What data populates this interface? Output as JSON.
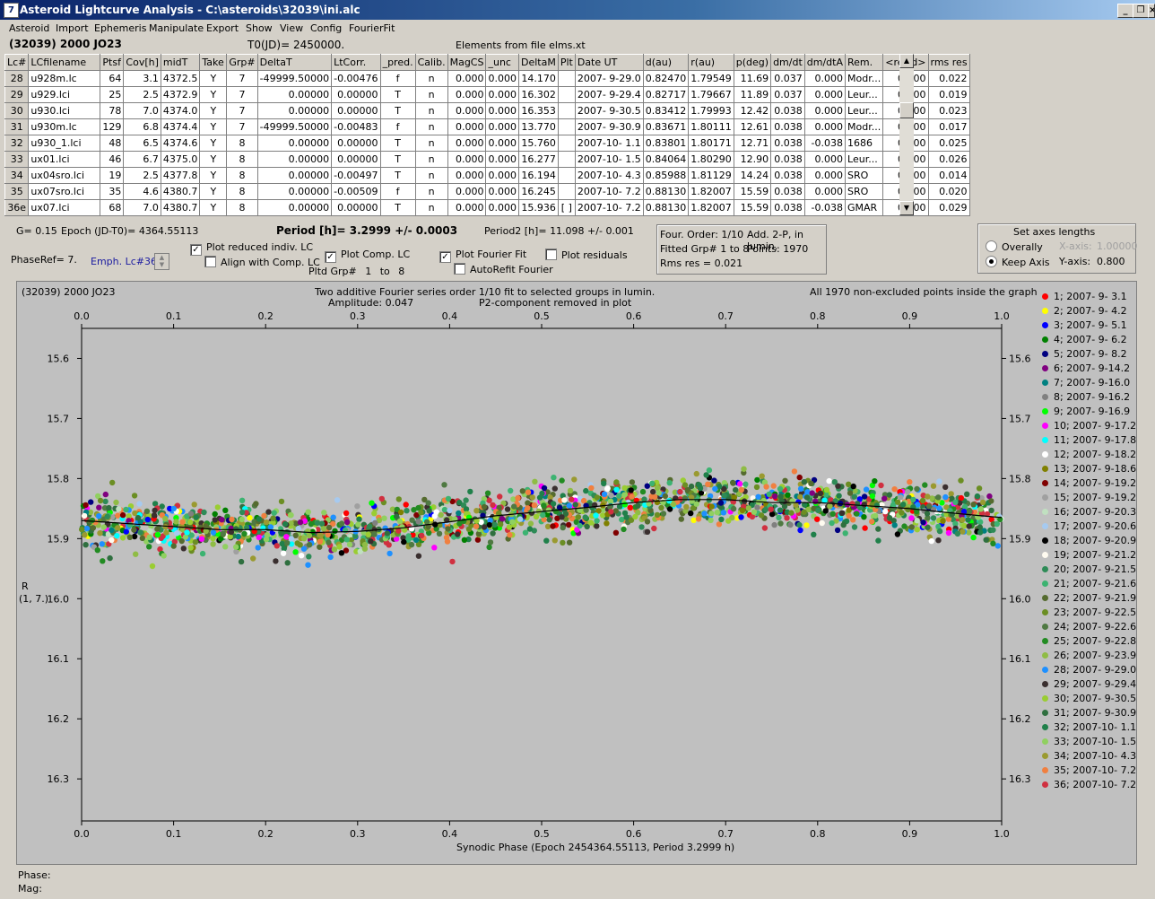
{
  "window": {
    "title": "Asteroid Lightcurve Analysis - C:\\asteroids\\32039\\ini.alc",
    "icon": "app-icon"
  },
  "menu": [
    "Asteroid",
    "Import",
    "Ephemeris",
    "Manipulate",
    "Export",
    "Show",
    "View",
    "Config",
    "FourierFit"
  ],
  "header": {
    "object": "(32039) 2000 JO23",
    "t0": "T0(JD)= 2450000.",
    "elements": "Elements from file elms.xt"
  },
  "table": {
    "columns": [
      "Lc#",
      "LCfilename",
      "Ptsf",
      "Cov[h]",
      "midT",
      "Take",
      "Grp#",
      "DeltaT",
      "LtCorr.",
      "_pred.",
      "Calib.",
      "MagCS",
      "_unc",
      "DeltaM",
      "Plt",
      "Date UT",
      "d(au)",
      "r(au)",
      "p(deg)",
      "dm/dt",
      "dm/dtA",
      "Rem.",
      "<resid>",
      "rms res"
    ],
    "rows": [
      [
        "28",
        "u928m.lc",
        "64",
        "3.1",
        "4372.5",
        "Y",
        "7",
        "-49999.50000",
        "-0.00476",
        "f",
        "n",
        "0.000",
        "0.000",
        "14.170",
        "",
        "2007- 9-29.0",
        "0.82470",
        "1.79549",
        "11.69",
        "0.037",
        "0.000",
        "Modr...",
        "0.000",
        "0.022"
      ],
      [
        "29",
        "u929.lci",
        "25",
        "2.5",
        "4372.9",
        "Y",
        "7",
        "0.00000",
        "0.00000",
        "T",
        "n",
        "0.000",
        "0.000",
        "16.302",
        "",
        "2007- 9-29.4",
        "0.82717",
        "1.79667",
        "11.89",
        "0.037",
        "0.000",
        "Leur...",
        "0.000",
        "0.019"
      ],
      [
        "30",
        "u930.lci",
        "78",
        "7.0",
        "4374.0",
        "Y",
        "7",
        "0.00000",
        "0.00000",
        "T",
        "n",
        "0.000",
        "0.000",
        "16.353",
        "",
        "2007- 9-30.5",
        "0.83412",
        "1.79993",
        "12.42",
        "0.038",
        "0.000",
        "Leur...",
        "0.000",
        "0.023"
      ],
      [
        "31",
        "u930m.lc",
        "129",
        "6.8",
        "4374.4",
        "Y",
        "7",
        "-49999.50000",
        "-0.00483",
        "f",
        "n",
        "0.000",
        "0.000",
        "13.770",
        "",
        "2007- 9-30.9",
        "0.83671",
        "1.80111",
        "12.61",
        "0.038",
        "0.000",
        "Modr...",
        "0.000",
        "0.017"
      ],
      [
        "32",
        "u930_1.lci",
        "48",
        "6.5",
        "4374.6",
        "Y",
        "8",
        "0.00000",
        "0.00000",
        "T",
        "n",
        "0.000",
        "0.000",
        "15.760",
        "",
        "2007-10- 1.1",
        "0.83801",
        "1.80171",
        "12.71",
        "0.038",
        "-0.038",
        "1686",
        "0.000",
        "0.025"
      ],
      [
        "33",
        "ux01.lci",
        "46",
        "6.7",
        "4375.0",
        "Y",
        "8",
        "0.00000",
        "0.00000",
        "T",
        "n",
        "0.000",
        "0.000",
        "16.277",
        "",
        "2007-10- 1.5",
        "0.84064",
        "1.80290",
        "12.90",
        "0.038",
        "0.000",
        "Leur...",
        "0.000",
        "0.026"
      ],
      [
        "34",
        "ux04sro.lci",
        "19",
        "2.5",
        "4377.8",
        "Y",
        "8",
        "0.00000",
        "-0.00497",
        "T",
        "n",
        "0.000",
        "0.000",
        "16.194",
        "",
        "2007-10- 4.3",
        "0.85988",
        "1.81129",
        "14.24",
        "0.038",
        "0.000",
        "SRO",
        "0.000",
        "0.014"
      ],
      [
        "35",
        "ux07sro.lci",
        "35",
        "4.6",
        "4380.7",
        "Y",
        "8",
        "0.00000",
        "-0.00509",
        "f",
        "n",
        "0.000",
        "0.000",
        "16.245",
        "",
        "2007-10- 7.2",
        "0.88130",
        "1.82007",
        "15.59",
        "0.038",
        "0.000",
        "SRO",
        "0.000",
        "0.020"
      ],
      [
        "36e",
        "ux07.lci",
        "68",
        "7.0",
        "4380.7",
        "Y",
        "8",
        "0.00000",
        "0.00000",
        "T",
        "n",
        "0.000",
        "0.000",
        "15.936",
        "[ ]",
        "2007-10- 7.2",
        "0.88130",
        "1.82007",
        "15.59",
        "0.038",
        "-0.038",
        "GMAR",
        "0.000",
        "0.029"
      ]
    ]
  },
  "info": {
    "g": "G= 0.15",
    "epoch": "Epoch (JD-T0)= 4364.55113",
    "period": "Period [h]= 3.2999 +/- 0.0003",
    "period2": "Period2 [h]= 11.098 +/- 0.001",
    "phaseref": "PhaseRef= 7.",
    "emph": "Emph. Lc#36:",
    "pltd_grp_label": "Pltd Grp#",
    "pltd_from": "1",
    "pltd_to_label": "to",
    "pltd_to": "8"
  },
  "checks": {
    "plot_reduced": {
      "label": "Plot reduced indiv. LC",
      "checked": true
    },
    "align": {
      "label": "Align with Comp. LC",
      "checked": false
    },
    "plot_comp": {
      "label": "Plot Comp. LC",
      "checked": true
    },
    "plot_fourier": {
      "label": "Plot Fourier Fit",
      "checked": true
    },
    "autorefit": {
      "label": "AutoRefit Fourier",
      "checked": false
    },
    "plot_residuals": {
      "label": "Plot residuals",
      "checked": false
    }
  },
  "fourier_box": {
    "order": "Four. Order:  1/10",
    "add": "Add. 2-P, in lumin.",
    "fitted": "Fitted Grp# 1 to 8",
    "points": "Points: 1970",
    "rms": "Rms res     = 0.021"
  },
  "axes_box": {
    "title": "Set axes lengths",
    "overally": "Overally",
    "keep": "Keep Axis",
    "xlabel": "X-axis:",
    "xval": "1.00000",
    "ylabel": "Y-axis:",
    "yval": "0.800"
  },
  "plot_text": {
    "object": "(32039) 2000 JO23",
    "line1": "Two additive Fourier series order 1/10 fit to selected groups in lumin.",
    "line2": "Amplitude: 0.047",
    "line3": "P2-component removed in plot",
    "right": "All 1970 non-excluded points inside the graph",
    "ylabel1": "R",
    "ylabel2": "(1, 7.)",
    "xlabel": "Synodic Phase (Epoch 2454364.55113, Period 3.2999 h)"
  },
  "status": {
    "phase": "Phase:",
    "mag": "Mag:"
  },
  "chart_data": {
    "type": "scatter",
    "xlim": [
      0,
      1
    ],
    "ylim": [
      15.55,
      16.37
    ],
    "y_inverted": true,
    "xticks": [
      "0.0",
      "0.1",
      "0.2",
      "0.3",
      "0.4",
      "0.5",
      "0.6",
      "0.7",
      "0.8",
      "0.9",
      "1.0"
    ],
    "yticks": [
      "15.6",
      "15.7",
      "15.8",
      "15.9",
      "16.0",
      "16.1",
      "16.2",
      "16.3"
    ],
    "fit_curve": {
      "x": [
        0.0,
        0.05,
        0.1,
        0.15,
        0.2,
        0.25,
        0.3,
        0.35,
        0.4,
        0.45,
        0.5,
        0.55,
        0.6,
        0.65,
        0.7,
        0.75,
        0.8,
        0.85,
        0.9,
        0.95,
        1.0
      ],
      "y": [
        15.87,
        15.875,
        15.88,
        15.885,
        15.885,
        15.89,
        15.888,
        15.882,
        15.872,
        15.862,
        15.855,
        15.848,
        15.84,
        15.835,
        15.835,
        15.84,
        15.84,
        15.845,
        15.85,
        15.858,
        15.865
      ]
    },
    "point_count": 1970,
    "scatter_sigma": 0.02,
    "legend": [
      {
        "label": "1; 2007- 9- 3.1",
        "color": "#ff0000"
      },
      {
        "label": "2; 2007- 9- 4.2",
        "color": "#ffff00"
      },
      {
        "label": "3; 2007- 9- 5.1",
        "color": "#0000ff"
      },
      {
        "label": "4; 2007- 9- 6.2",
        "color": "#008000"
      },
      {
        "label": "5; 2007- 9- 8.2",
        "color": "#000080"
      },
      {
        "label": "6; 2007- 9-14.2",
        "color": "#800080"
      },
      {
        "label": "7; 2007- 9-16.0",
        "color": "#008080"
      },
      {
        "label": "8; 2007- 9-16.2",
        "color": "#808080"
      },
      {
        "label": "9; 2007- 9-16.9",
        "color": "#00ff00"
      },
      {
        "label": "10; 2007- 9-17.2",
        "color": "#ff00ff"
      },
      {
        "label": "11; 2007- 9-17.8",
        "color": "#00ffff"
      },
      {
        "label": "12; 2007- 9-18.2",
        "color": "#ffffff"
      },
      {
        "label": "13; 2007- 9-18.6",
        "color": "#808000"
      },
      {
        "label": "14; 2007- 9-19.2",
        "color": "#800000"
      },
      {
        "label": "15; 2007- 9-19.2",
        "color": "#a0a0a0"
      },
      {
        "label": "16; 2007- 9-20.3",
        "color": "#c0e0c0"
      },
      {
        "label": "17; 2007- 9-20.6",
        "color": "#a6caf0"
      },
      {
        "label": "18; 2007- 9-20.9",
        "color": "#000000"
      },
      {
        "label": "19; 2007- 9-21.2",
        "color": "#fffbf0"
      },
      {
        "label": "20; 2007- 9-21.5",
        "color": "#2e8b57"
      },
      {
        "label": "21; 2007- 9-21.6",
        "color": "#3cb371"
      },
      {
        "label": "22; 2007- 9-21.9",
        "color": "#556b2f"
      },
      {
        "label": "23; 2007- 9-22.5",
        "color": "#6b8e23"
      },
      {
        "label": "24; 2007- 9-22.6",
        "color": "#4f7942"
      },
      {
        "label": "25; 2007- 9-22.8",
        "color": "#228b22"
      },
      {
        "label": "26; 2007- 9-23.9",
        "color": "#8fbc45"
      },
      {
        "label": "28; 2007- 9-29.0",
        "color": "#1e90ff"
      },
      {
        "label": "29; 2007- 9-29.4",
        "color": "#3a2f2f"
      },
      {
        "label": "30; 2007- 9-30.5",
        "color": "#9acd32"
      },
      {
        "label": "31; 2007- 9-30.9",
        "color": "#2f6f3f"
      },
      {
        "label": "32; 2007-10- 1.1",
        "color": "#20804a"
      },
      {
        "label": "33; 2007-10- 1.5",
        "color": "#90d060"
      },
      {
        "label": "34; 2007-10- 4.3",
        "color": "#9a9a30"
      },
      {
        "label": "35; 2007-10- 7.2",
        "color": "#f08040"
      },
      {
        "label": "36; 2007-10- 7.2",
        "color": "#d03040"
      }
    ]
  }
}
